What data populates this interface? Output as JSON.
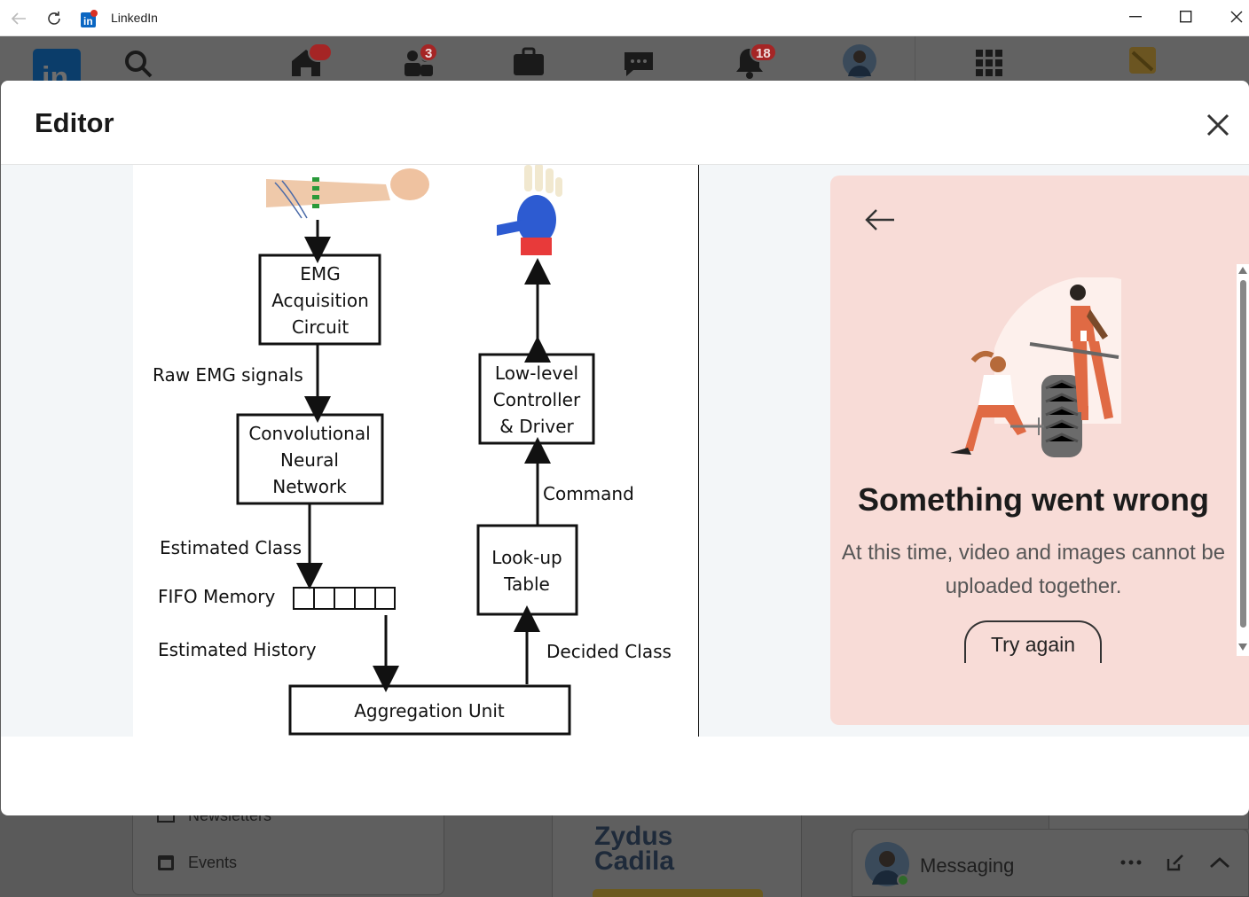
{
  "window": {
    "title": "LinkedIn",
    "icons": [
      "back-arrow-icon",
      "refresh-icon",
      "linkedin-icon",
      "minimize-icon",
      "maximize-icon",
      "close-icon"
    ]
  },
  "nav": {
    "badges": {
      "home": "",
      "network": "3",
      "notifications": "18"
    },
    "icons": [
      "linkedin-logo",
      "search-icon",
      "home-icon",
      "network-icon",
      "jobs-icon",
      "messaging-icon",
      "notifications-icon",
      "avatar",
      "apps-grid-icon",
      "premium-icon"
    ]
  },
  "modal": {
    "title": "Editor",
    "close_icon": "close-icon"
  },
  "diagram": {
    "emg_circuit": [
      "EMG",
      "Acquisition",
      "Circuit"
    ],
    "raw_signals": "Raw EMG signals",
    "cnn": [
      "Convolutional",
      "Neural",
      "Network"
    ],
    "estimated_class": "Estimated Class",
    "fifo": "FIFO Memory",
    "estimated_history": "Estimated History",
    "aggregation": "Aggregation Unit",
    "decided_class": "Decided Class",
    "lookup": [
      "Look-up",
      "Table"
    ],
    "command": "Command",
    "controller": [
      "Low-level",
      "Controller",
      "& Driver"
    ]
  },
  "error_panel": {
    "title": "Something went wrong",
    "message_line1": "At this time, video and images cannot be",
    "message_line2": "uploaded together.",
    "retry_label": "Try again",
    "back_icon": "arrow-left-icon"
  },
  "background": {
    "sidebar": {
      "newsletters": "Newsletters",
      "events": "Events"
    },
    "ad_brand": [
      "Zydus",
      "Cadila"
    ],
    "messaging": {
      "label": "Messaging"
    }
  },
  "colors": {
    "error_panel_bg": "#f8dcd7",
    "badge": "#a52525",
    "overlay_dim": "#5b5b5b",
    "illustration_orange": "#e06a44"
  }
}
